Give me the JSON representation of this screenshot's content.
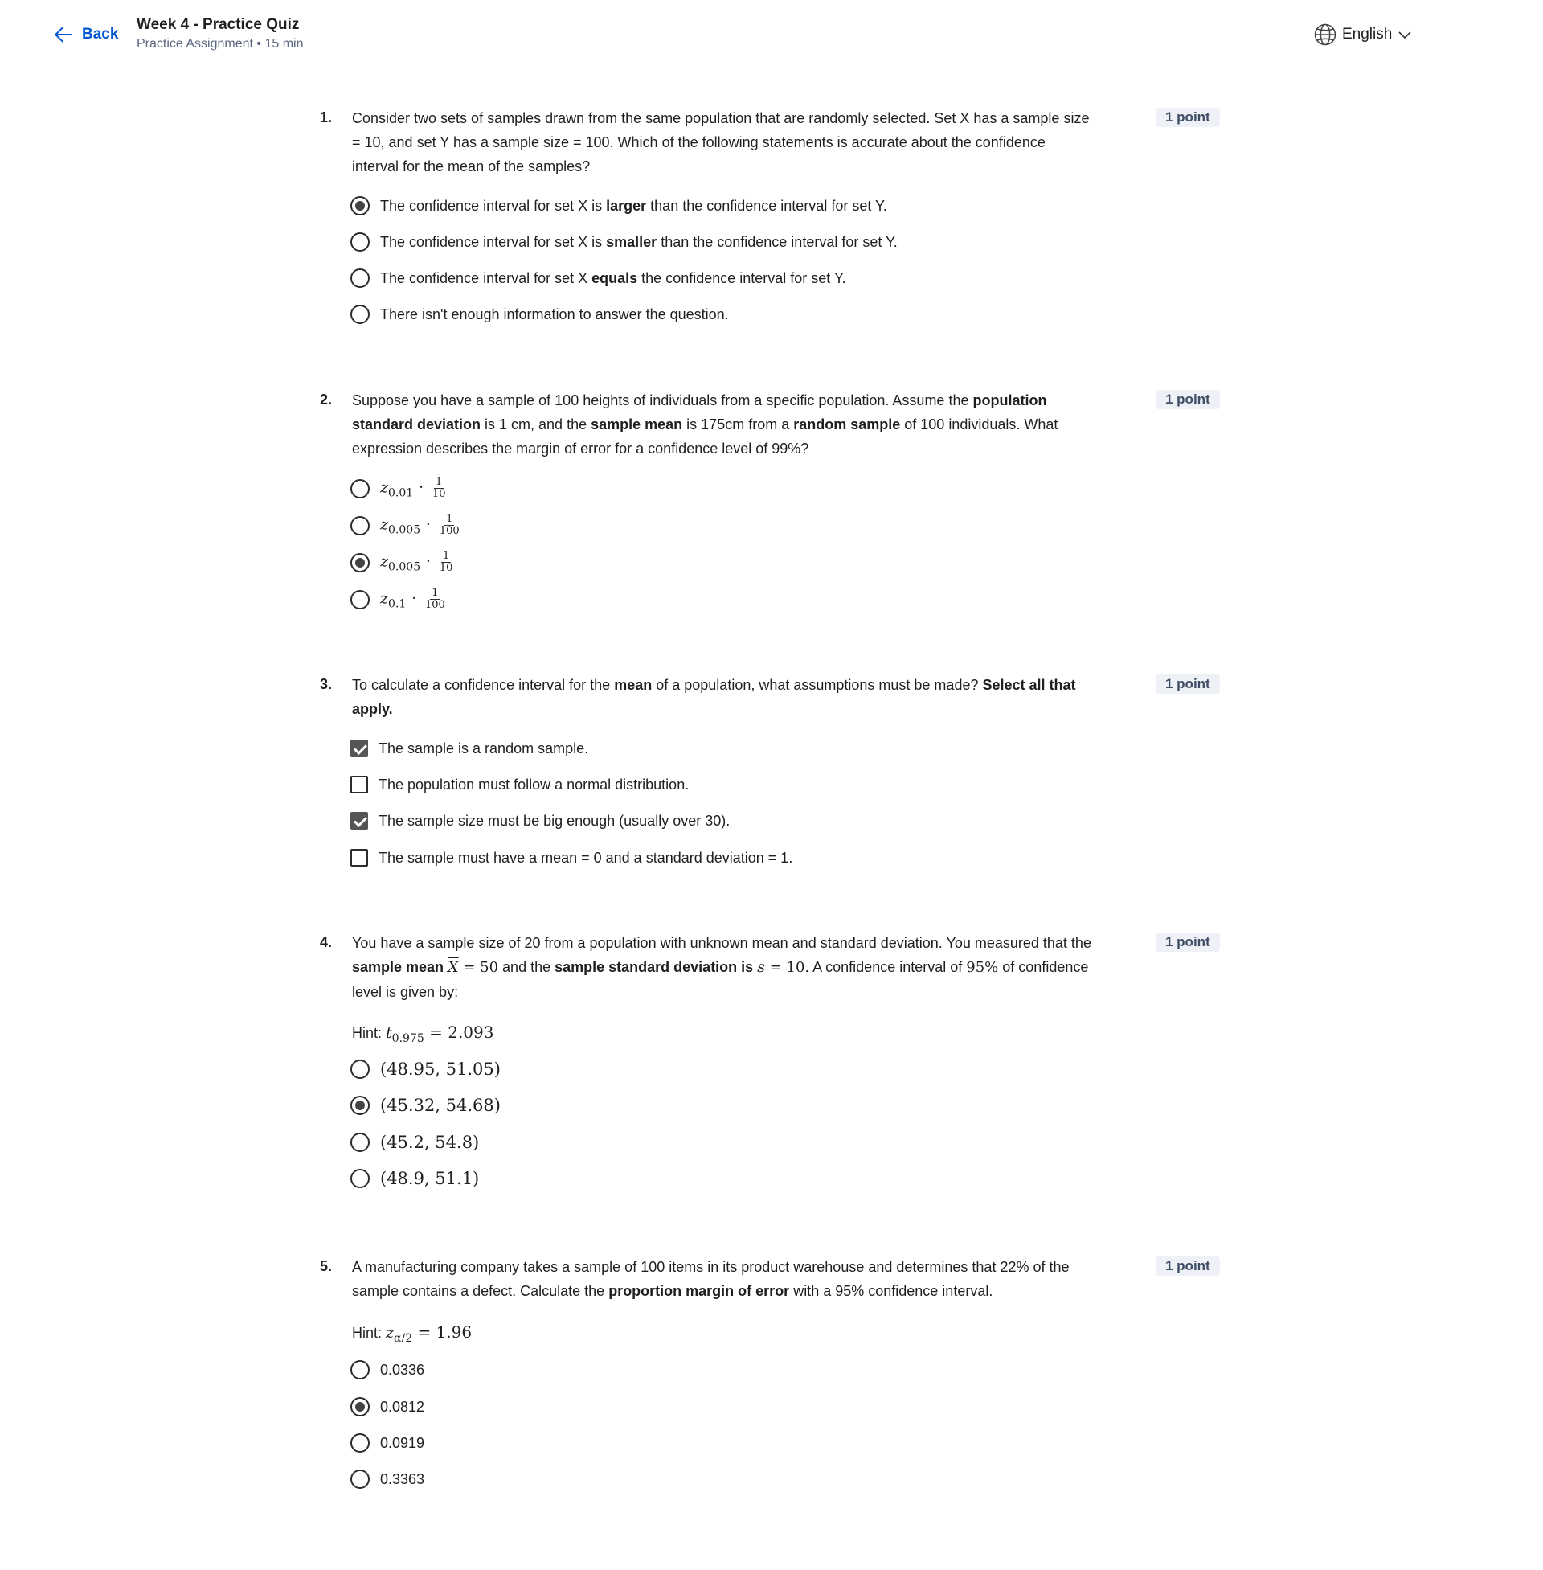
{
  "header": {
    "back_label": "Back",
    "title": "Week 4 - Practice Quiz",
    "subtitle": "Practice Assignment • 15 min",
    "language": "English"
  },
  "questions": [
    {
      "number": "1.",
      "points": "1 point",
      "text_parts": [
        "Consider two sets of samples drawn from the same population that are randomly selected. Set X has a sample size = 10, and set Y has a sample size = 100. Which of the following statements is accurate about the confidence interval for the mean of the samples?"
      ],
      "type": "radio",
      "options": [
        {
          "pre": "The confidence interval for set X is ",
          "bold": "larger",
          "post": " than the confidence interval for set Y.",
          "selected": true
        },
        {
          "pre": "The confidence interval for set X is ",
          "bold": "smaller",
          "post": " than the confidence interval for set Y.",
          "selected": false
        },
        {
          "pre": "The confidence interval for set X ",
          "bold": "equals",
          "post": " the confidence interval for set Y.",
          "selected": false
        },
        {
          "pre": "There isn't enough information to answer the question.",
          "bold": "",
          "post": "",
          "selected": false
        }
      ]
    },
    {
      "number": "2.",
      "points": "1 point",
      "text": {
        "p1": "Suppose you have a sample of 100 heights of individuals from a specific population. Assume the ",
        "b1": "population standard deviation",
        "p2": " is 1 cm, and the ",
        "b2": "sample mean",
        "p3": " is 175cm from a ",
        "b3": "random sample",
        "p4": " of 100 individuals. What expression describes the margin of error for a confidence level of 99%?"
      },
      "type": "radio",
      "options": [
        {
          "z": "z",
          "sub": "0.01",
          "num": "1",
          "den": "10",
          "selected": false
        },
        {
          "z": "z",
          "sub": "0.005",
          "num": "1",
          "den": "100",
          "selected": false
        },
        {
          "z": "z",
          "sub": "0.005",
          "num": "1",
          "den": "10",
          "selected": true
        },
        {
          "z": "z",
          "sub": "0.1",
          "num": "1",
          "den": "100",
          "selected": false
        }
      ]
    },
    {
      "number": "3.",
      "points": "1 point",
      "text": {
        "p1": "To calculate a confidence interval for the ",
        "b1": "mean",
        "p2": " of a population, what assumptions must be made? ",
        "b2": "Select all that apply."
      },
      "type": "checkbox",
      "options": [
        {
          "label": "The sample is a random sample.",
          "selected": true
        },
        {
          "label": "The population must follow a normal distribution.",
          "selected": false
        },
        {
          "label": "The sample size must be big enough (usually over 30).",
          "selected": true
        },
        {
          "label": "The sample must have a mean = 0 and a standard deviation = 1.",
          "selected": false
        }
      ]
    },
    {
      "number": "4.",
      "points": "1 point",
      "text": {
        "p1": "You have a sample size of 20 from a population with unknown mean and standard deviation. You measured that the ",
        "b1": "sample mean",
        "m1": "X",
        "m1b": " = 50",
        "p2": " and the ",
        "b2": "sample standard deviation is",
        "m2": "s",
        "m2b": " = 10.",
        "p3": " A confidence interval of ",
        "m3": "95%",
        "p4": " of confidence level is given by:"
      },
      "hint": {
        "label": "Hint: ",
        "var": "t",
        "sub": "0.975",
        "eq": " = 2.093"
      },
      "type": "radio",
      "options": [
        {
          "label": "(48.95, 51.05)",
          "selected": false
        },
        {
          "label": "(45.32, 54.68)",
          "selected": true
        },
        {
          "label": "(45.2, 54.8)",
          "selected": false
        },
        {
          "label": "(48.9, 51.1)",
          "selected": false
        }
      ]
    },
    {
      "number": "5.",
      "points": "1 point",
      "text": {
        "p1": "A manufacturing company takes a sample of 100 items in its product warehouse and determines that 22% of the sample contains a defect. Calculate the ",
        "b1": "proportion margin of error",
        "p2": " with a 95% confidence interval."
      },
      "hint": {
        "label": "Hint: ",
        "var": "z",
        "sub": "α/2",
        "eq": " = 1.96"
      },
      "type": "radio",
      "options": [
        {
          "label": "0.0336",
          "selected": false
        },
        {
          "label": "0.0812",
          "selected": true
        },
        {
          "label": "0.0919",
          "selected": false
        },
        {
          "label": "0.3363",
          "selected": false
        }
      ]
    }
  ],
  "colors": {
    "accent": "#0056d2",
    "points_bg": "#eef1f6",
    "points_text": "#3f4d66",
    "subtitle": "#5b6780"
  }
}
